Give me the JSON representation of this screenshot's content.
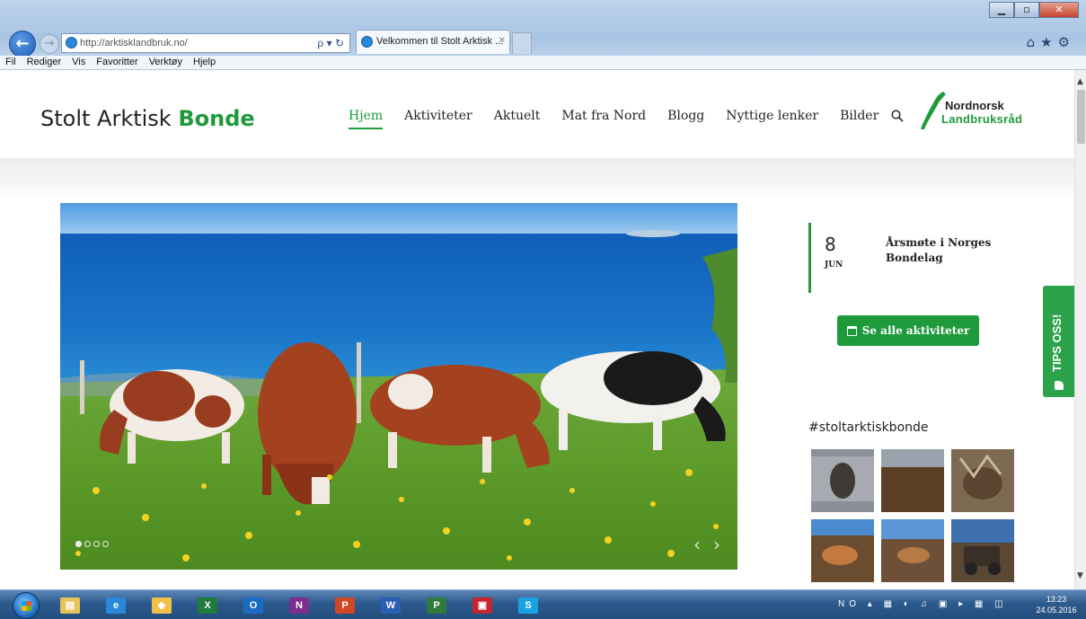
{
  "browser": {
    "address_url": "http://arktisklandbruk.no/",
    "address_tools": "ρ ▾ ↻",
    "tab_title": "Velkommen til Stolt Arktisk ...",
    "tab_close": "✕",
    "back_glyph": "←",
    "forward_glyph": "→",
    "window_minimize": "▁",
    "window_maximize": "▫",
    "window_close": "✕",
    "toolbar_icons": "⌂★⚙",
    "menu": [
      "Fil",
      "Rediger",
      "Vis",
      "Favoritter",
      "Verktøy",
      "Hjelp"
    ]
  },
  "site": {
    "logo_regular": "Stolt Arktisk ",
    "logo_bold": "Bonde",
    "nav": [
      {
        "label": "Hjem",
        "active": true
      },
      {
        "label": "Aktiviteter"
      },
      {
        "label": "Aktuelt"
      },
      {
        "label": "Mat fra Nord"
      },
      {
        "label": "Blogg"
      },
      {
        "label": "Nyttige lenker"
      },
      {
        "label": "Bilder"
      }
    ],
    "partner_top": "Nordnorsk",
    "partner_bottom": "Landbruksråd",
    "accent_color": "#1f9a3b"
  },
  "carousel": {
    "dots": 4,
    "active_dot": 0,
    "prev_glyph": "‹",
    "next_glyph": "›"
  },
  "event": {
    "day": "8",
    "month": "JUN",
    "title": "Årsmøte i Norges Bondelag"
  },
  "activities_button": "Se alle aktiviteter",
  "tips_label": "TIPS OSS!",
  "hashtag": "#stoltarktiskbonde",
  "taskbar": {
    "apps": [
      {
        "name": "explorer",
        "glyph": "▤",
        "color": "#e8c35a"
      },
      {
        "name": "internet-explorer",
        "glyph": "e",
        "color": "#2a88d8"
      },
      {
        "name": "folder",
        "glyph": "◆",
        "color": "#f0c04a"
      },
      {
        "name": "excel",
        "glyph": "X",
        "color": "#1f7a3c"
      },
      {
        "name": "outlook",
        "glyph": "O",
        "color": "#1a6cc2"
      },
      {
        "name": "onenote",
        "glyph": "N",
        "color": "#7b2f8f"
      },
      {
        "name": "powerpoint",
        "glyph": "P",
        "color": "#d24625"
      },
      {
        "name": "word",
        "glyph": "W",
        "color": "#2b5fb4"
      },
      {
        "name": "project",
        "glyph": "P",
        "color": "#2f7a3b"
      },
      {
        "name": "pdf",
        "glyph": "▣",
        "color": "#c4262e"
      },
      {
        "name": "skype",
        "glyph": "S",
        "color": "#1aa1e0"
      }
    ],
    "tray_text": "NO ▴ ▦ ◐ ♫ ▣ ▸ ▦ ◫",
    "time": "13:23",
    "date": "24.05.2016"
  }
}
